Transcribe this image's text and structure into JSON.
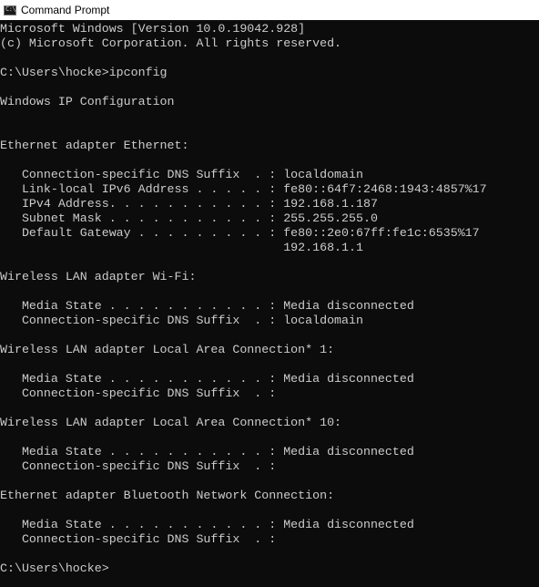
{
  "window": {
    "title": "Command Prompt",
    "icon": "cmd-icon",
    "icon_glyph": "C:\\"
  },
  "colors": {
    "background": "#0c0c0c",
    "text": "#cccccc",
    "titlebar": "#ffffff"
  },
  "console": {
    "lines": [
      "Microsoft Windows [Version 10.0.19042.928]",
      "(c) Microsoft Corporation. All rights reserved.",
      "",
      "C:\\Users\\hocke>ipconfig",
      "",
      "Windows IP Configuration",
      "",
      "",
      "Ethernet adapter Ethernet:",
      "",
      "   Connection-specific DNS Suffix  . : localdomain",
      "   Link-local IPv6 Address . . . . . : fe80::64f7:2468:1943:4857%17",
      "   IPv4 Address. . . . . . . . . . . : 192.168.1.187",
      "   Subnet Mask . . . . . . . . . . . : 255.255.255.0",
      "   Default Gateway . . . . . . . . . : fe80::2e0:67ff:fe1c:6535%17",
      "                                       192.168.1.1",
      "",
      "Wireless LAN adapter Wi-Fi:",
      "",
      "   Media State . . . . . . . . . . . : Media disconnected",
      "   Connection-specific DNS Suffix  . : localdomain",
      "",
      "Wireless LAN adapter Local Area Connection* 1:",
      "",
      "   Media State . . . . . . . . . . . : Media disconnected",
      "   Connection-specific DNS Suffix  . :",
      "",
      "Wireless LAN adapter Local Area Connection* 10:",
      "",
      "   Media State . . . . . . . . . . . : Media disconnected",
      "   Connection-specific DNS Suffix  . :",
      "",
      "Ethernet adapter Bluetooth Network Connection:",
      "",
      "   Media State . . . . . . . . . . . : Media disconnected",
      "   Connection-specific DNS Suffix  . :",
      "",
      "C:\\Users\\hocke>"
    ]
  }
}
